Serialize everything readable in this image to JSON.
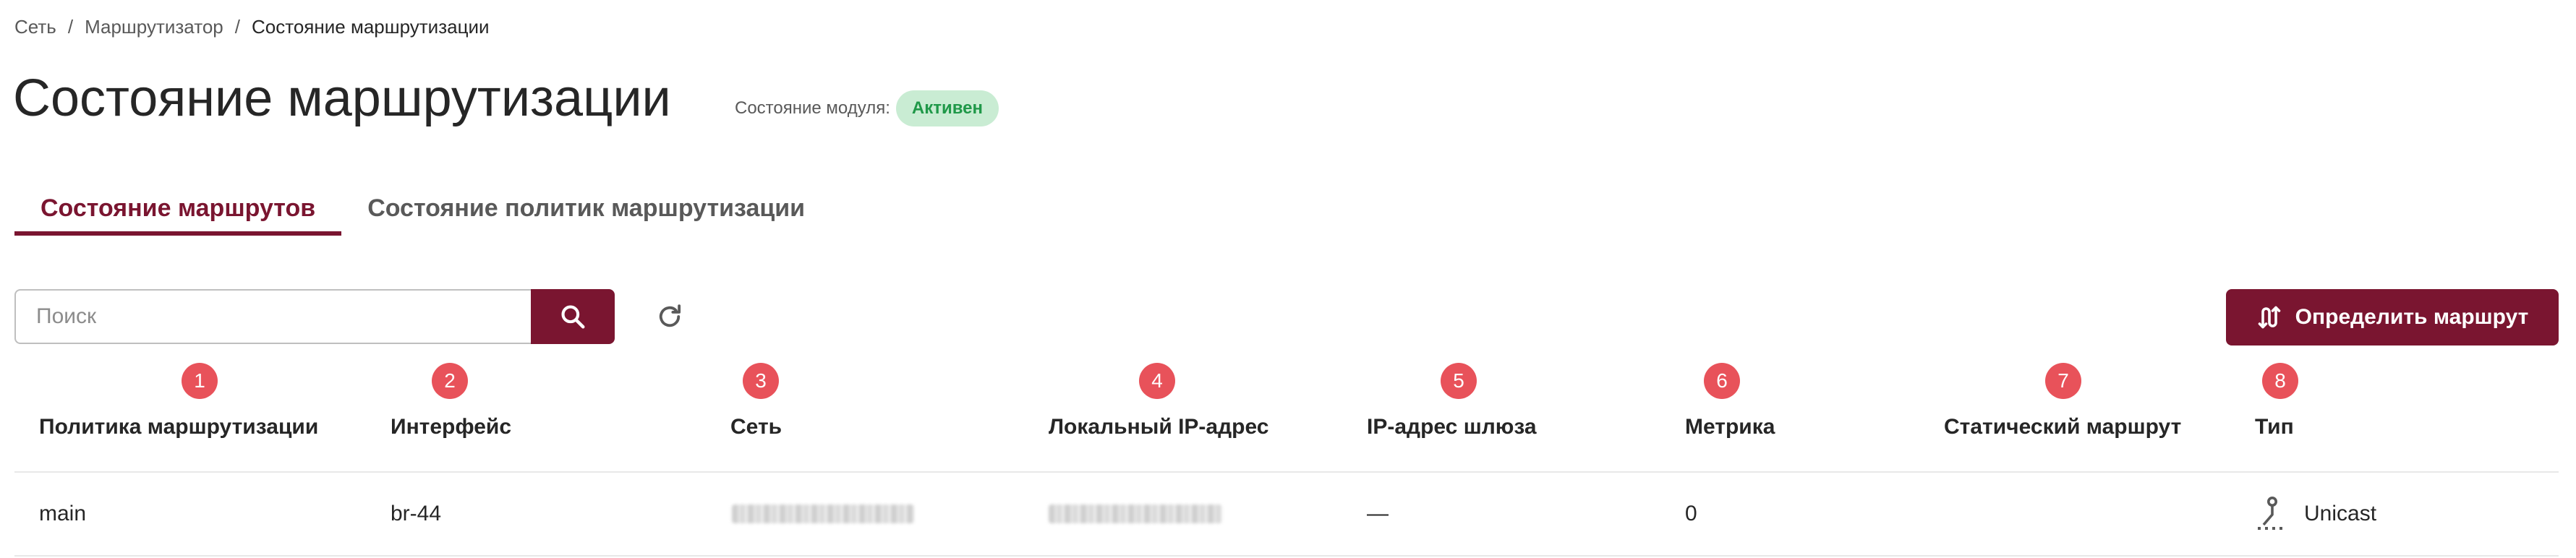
{
  "breadcrumb": {
    "items": [
      "Сеть",
      "Маршрутизатор"
    ],
    "current": "Состояние маршрутизации",
    "separator": "/"
  },
  "page": {
    "title": "Состояние маршрутизации",
    "module_status_label": "Состояние модуля:",
    "module_status_value": "Активен"
  },
  "tabs": [
    {
      "label": "Состояние маршрутов",
      "active": true
    },
    {
      "label": "Состояние политик маршрутизации",
      "active": false
    }
  ],
  "toolbar": {
    "search_placeholder": "Поиск",
    "search_icon": "search-icon",
    "refresh_icon": "refresh-icon",
    "define_route_label": "Определить маршрут",
    "define_route_icon": "route-icon"
  },
  "markers": [
    "1",
    "2",
    "3",
    "4",
    "5",
    "6",
    "7",
    "8"
  ],
  "table": {
    "columns": [
      "Политика маршрутизации",
      "Интерфейс",
      "Сеть",
      "Локальный IP-адрес",
      "IP-адрес шлюза",
      "Метрика",
      "Статический маршрут",
      "Тип"
    ],
    "rows": [
      {
        "policy": "main",
        "interface": "br-44",
        "gateway": "—",
        "metric": "0",
        "static_route": "",
        "type": "Unicast",
        "type_icon": "unicast-icon"
      }
    ]
  },
  "colors": {
    "accent": "#7a1530",
    "status_bg": "#c9ecd3",
    "status_text": "#1f9848",
    "marker": "#e8525a"
  }
}
